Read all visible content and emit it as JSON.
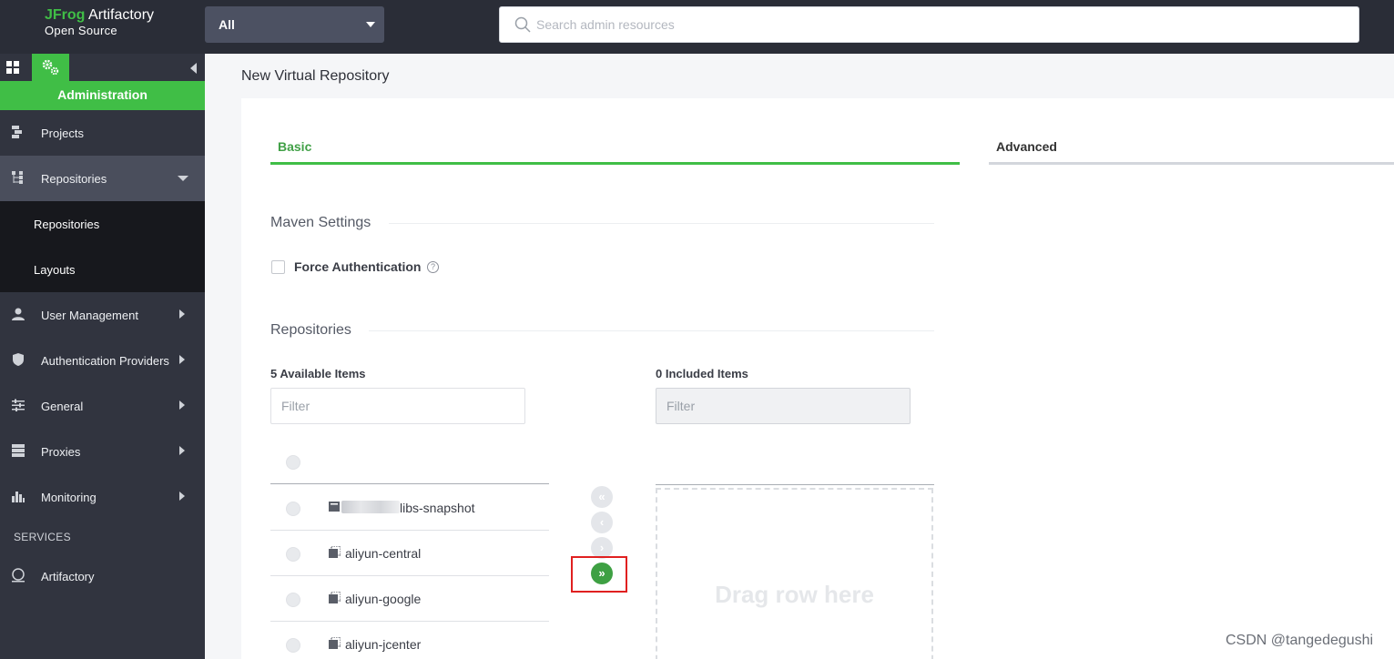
{
  "brand": {
    "name_green": "JFrog",
    "name_white": " Artifactory",
    "edition": "Open Source"
  },
  "scope_select": {
    "value": "All"
  },
  "search": {
    "placeholder": "Search admin resources"
  },
  "sidebar": {
    "section": "Administration",
    "items": [
      {
        "label": "Projects",
        "icon": "projects-icon"
      },
      {
        "label": "Repositories",
        "icon": "repositories-icon",
        "expanded": true,
        "children": [
          {
            "label": "Repositories"
          },
          {
            "label": "Layouts"
          }
        ]
      },
      {
        "label": "User Management",
        "icon": "user-icon"
      },
      {
        "label": "Authentication Providers",
        "icon": "shield-icon"
      },
      {
        "label": "General",
        "icon": "sliders-icon"
      },
      {
        "label": "Proxies",
        "icon": "server-icon"
      },
      {
        "label": "Monitoring",
        "icon": "bar-chart-icon"
      }
    ],
    "services_heading": "SERVICES",
    "services": [
      {
        "label": "Artifactory",
        "icon": "artifactory-icon"
      }
    ]
  },
  "page": {
    "title": "New Virtual Repository"
  },
  "tabs": [
    {
      "label": "Basic",
      "active": true
    },
    {
      "label": "Advanced",
      "active": false
    }
  ],
  "maven": {
    "title": "Maven Settings",
    "force_auth_label": "Force Authentication",
    "force_auth_checked": false,
    "help_glyph": "?"
  },
  "repositories": {
    "title": "Repositories",
    "available": {
      "count_label": "5 Available Items",
      "filter_placeholder": "Filter",
      "items": [
        "libs-snapshot",
        "aliyun-central",
        "aliyun-google",
        "aliyun-jcenter"
      ]
    },
    "included": {
      "count_label": "0 Included Items",
      "filter_placeholder": "Filter",
      "drop_text": "Drag row here"
    },
    "buttons": {
      "remove_all": "«",
      "remove_one": "‹",
      "add_one": "›",
      "add_all": "»"
    }
  },
  "watermark": "CSDN @tangedegushi",
  "colors": {
    "accent": "#40be46",
    "topbar": "#2a2d37",
    "sidebar": "#31343f",
    "highlight": "#e02020"
  }
}
